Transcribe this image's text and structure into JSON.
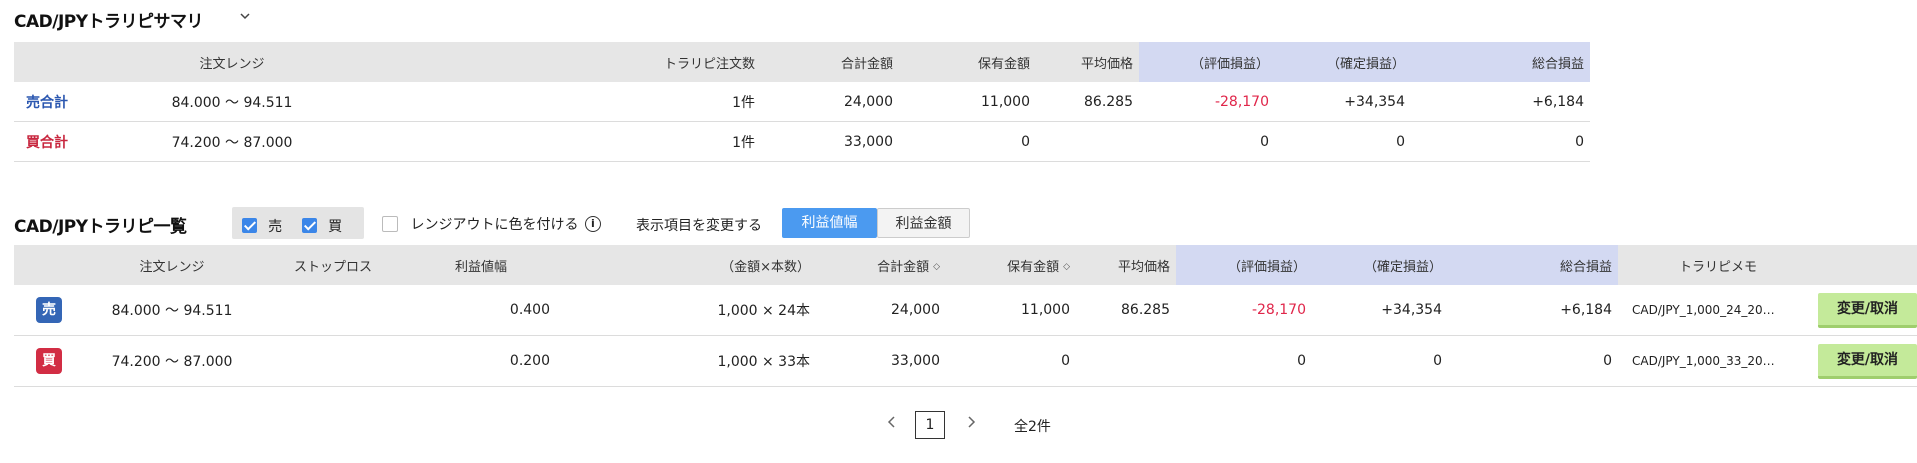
{
  "summary": {
    "title": "CAD/JPYトラリピサマリ",
    "headers": [
      "注文レンジ",
      "トラリピ注文数",
      "合計金額",
      "保有金額",
      "平均価格",
      "（評価損益）",
      "（確定損益）",
      "総合損益"
    ],
    "rows": [
      {
        "label": "売合計",
        "range": "84.000 〜 94.511",
        "count": "1件",
        "total": "24,000",
        "held": "11,000",
        "avg": "86.285",
        "unrealized": "-28,170",
        "realized": "+34,354",
        "overall": "+6,184"
      },
      {
        "label": "買合計",
        "range": "74.200 〜 87.000",
        "count": "1件",
        "total": "33,000",
        "held": "0",
        "avg": "",
        "unrealized": "0",
        "realized": "0",
        "overall": "0"
      }
    ]
  },
  "list": {
    "title": "CAD/JPYトラリピ一覧",
    "filters": {
      "sell": "売",
      "buy": "買"
    },
    "range_color_label": "レンジアウトに色を付ける",
    "change_display_label": "表示項目を変更する",
    "toggle": {
      "profit_width": "利益値幅",
      "profit_amount": "利益金額"
    },
    "headers": [
      "注文レンジ",
      "ストップロス",
      "利益値幅",
      "（金額×本数）",
      "合計金額",
      "保有金額",
      "平均価格",
      "（評価損益）",
      "（確定損益）",
      "総合損益",
      "トラリピメモ"
    ],
    "rows": [
      {
        "side": "売",
        "range": "84.000 〜 94.511",
        "stop": "",
        "width": "0.400",
        "amount": "1,000 × 24本",
        "total": "24,000",
        "held": "11,000",
        "avg": "86.285",
        "unrealized": "-28,170",
        "realized": "+34,354",
        "overall": "+6,184",
        "memo": "CAD/JPY_1,000_24_20…",
        "action": "変更/取消"
      },
      {
        "side": "買",
        "range": "74.200 〜 87.000",
        "stop": "",
        "width": "0.200",
        "amount": "1,000 × 33本",
        "total": "33,000",
        "held": "0",
        "avg": "",
        "unrealized": "0",
        "realized": "0",
        "overall": "0",
        "memo": "CAD/JPY_1,000_33_20…",
        "action": "変更/取消"
      }
    ]
  },
  "pagination": {
    "current": "1",
    "total_label": "全2件"
  },
  "icons": {
    "dropdown": "chevron-down-icon",
    "prev": "chevron-left-icon",
    "next": "chevron-right-icon",
    "info": "info-icon",
    "sort": "sort-icon"
  },
  "colors": {
    "negative": "#e0264a",
    "sell": "#2b57b0",
    "buy": "#c8273f",
    "accent": "#4b9af0",
    "action": "#c4ea9a"
  }
}
